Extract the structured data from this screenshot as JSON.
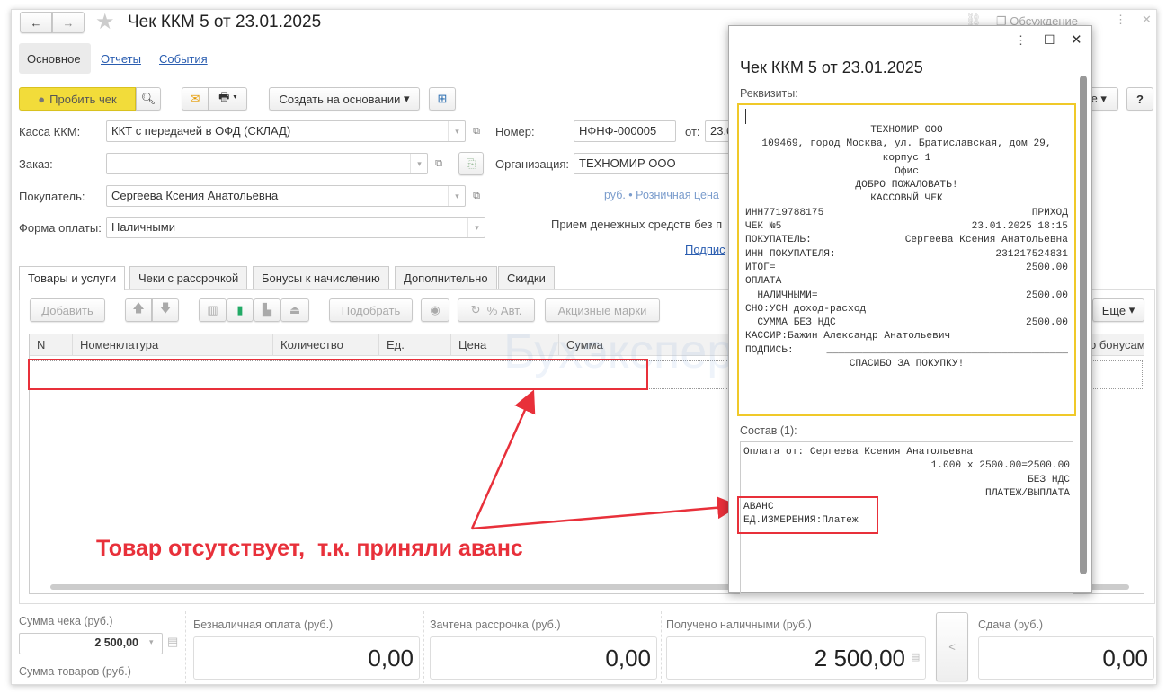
{
  "window": {
    "title": "Чек ККМ 5 от 23.01.2025",
    "discussion": "Обсуждение"
  },
  "nav": {
    "tabs": [
      "Основное",
      "Отчеты",
      "События"
    ]
  },
  "toolbar": {
    "print_check": "Пробить чек",
    "create_based": "Создать на основании",
    "more": "Еще",
    "help": "?"
  },
  "form": {
    "kassa_label": "Касса ККМ:",
    "kassa_value": "ККТ с передачей в ОФД (СКЛАД)",
    "order_label": "Заказ:",
    "order_value": "",
    "buyer_label": "Покупатель:",
    "buyer_value": "Сергеева Ксения Анатольевна",
    "payment_label": "Форма оплаты:",
    "payment_value": "Наличными",
    "number_label": "Номер:",
    "number_value": "НФНФ-000005",
    "from_label": "от:",
    "from_value": "23.0",
    "org_label": "Организация:",
    "org_value": "ТЕХНОМИР ООО",
    "price_link": "руб. • Розничная цена",
    "cash_note": "Прием денежных средств без п",
    "sign_link": "Подпис"
  },
  "tabs": [
    "Товары и услуги",
    "Чеки с рассрочкой",
    "Бонусы к начислению",
    "Дополнительно",
    "Скидки"
  ],
  "table_toolbar": {
    "add": "Добавить",
    "pick": "Подобрать",
    "auto": "% Авт.",
    "excise": "Акцизные марки",
    "more": "Еще"
  },
  "table": {
    "columns": [
      "N",
      "Номенклатура",
      "Количество",
      "Ед.",
      "Цена",
      "Сумма"
    ],
    "last_column": "о бонусам"
  },
  "annotation": {
    "text": "Товар отсутствует,  т.к. приняли аванс",
    "color": "#e8303a"
  },
  "footer": {
    "check_sum_label": "Сумма чека (руб.)",
    "check_sum_value": "2 500,00",
    "goods_sum_label": "Сумма товаров (руб.)",
    "cashless_label": "Безналичная оплата (руб.)",
    "cashless_value": "0,00",
    "installment_label": "Зачтена рассрочка (руб.)",
    "installment_value": "0,00",
    "cash_label": "Получено наличными (руб.)",
    "cash_value": "2 500,00",
    "change_label": "Сдача (руб.)",
    "change_value": "0,00",
    "collapse": "<"
  },
  "popup": {
    "title": "Чек ККМ 5 от 23.01.2025",
    "requisites_label": "Реквизиты:",
    "receipt": [
      {
        "c": "ТЕХНОМИР ООО"
      },
      {
        "c": "109469, город Москва, ул. Братиславская, дом 29,"
      },
      {
        "c": "корпус 1"
      },
      {
        "c": "Офис"
      },
      {
        "c": "ДОБРО ПОЖАЛОВАТЬ!"
      },
      {
        "c": "КАССОВЫЙ ЧЕК"
      },
      {
        "l": "ИНН7719788175",
        "r": "ПРИХОД"
      },
      {
        "l": "ЧЕК №5",
        "r": "23.01.2025 18:15"
      },
      {
        "l": "ПОКУПАТЕЛЬ:",
        "r": "Сергеева Ксения Анатольевна"
      },
      {
        "l": "ИНН ПОКУПАТЕЛЯ:",
        "r": "231217524831"
      },
      {
        "l": "ИТОГ=",
        "r": "2500.00"
      },
      {
        "l": "ОПЛАТА",
        "r": ""
      },
      {
        "l": "  НАЛИЧНЫМИ=",
        "r": "2500.00"
      },
      {
        "l": "СНО:УСН доход-расход",
        "r": ""
      },
      {
        "l": "  СУММА БЕЗ НДС",
        "r": "2500.00"
      },
      {
        "l": "КАССИР:Бажин Александр Анатольевич",
        "r": ""
      },
      {
        "l": "ПОДПИСЬ:",
        "r": "________________________________________"
      },
      {
        "c": "СПАСИБО ЗА ПОКУПКУ!"
      }
    ],
    "composition_label": "Состав (1):",
    "composition": [
      {
        "l": "Оплата от: Сергеева Ксения Анатольевна",
        "r": ""
      },
      {
        "l": "",
        "r": "1.000 x 2500.00=2500.00"
      },
      {
        "l": "",
        "r": "БЕЗ НДС"
      },
      {
        "l": "",
        "r": "ПЛАТЕЖ/ВЫПЛАТА"
      },
      {
        "l": "АВАНС",
        "r": ""
      },
      {
        "l": "ЕД.ИЗМЕРЕНИЯ:Платеж",
        "r": ""
      }
    ]
  }
}
